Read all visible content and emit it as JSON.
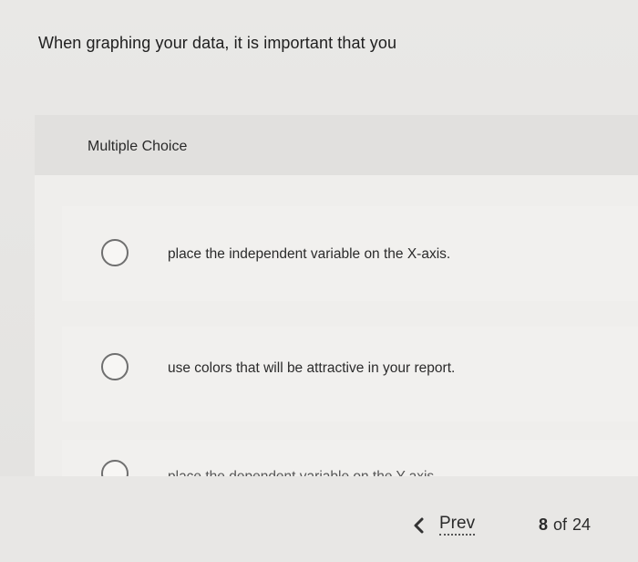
{
  "question": {
    "prompt": "When graphing your data, it is important that you"
  },
  "card": {
    "question_type": "Multiple Choice",
    "options": [
      {
        "label": "place the independent variable on the X-axis.",
        "selected": false
      },
      {
        "label": "use colors that will be attractive in your report.",
        "selected": false
      },
      {
        "label": "place the dependent variable on the Y-axis.",
        "selected": false
      }
    ]
  },
  "footer": {
    "prev_label": "Prev",
    "current_page": "8",
    "separator": "of",
    "total_pages": "24"
  },
  "colors": {
    "background": "#e6e5e3",
    "card": "#efeeec",
    "card_header": "#e1e0de",
    "radio_border": "#6f6f6f",
    "text": "#2a2a2a"
  },
  "icons": {
    "prev": "chevron-left-icon",
    "radio": "radio-circle-icon"
  }
}
